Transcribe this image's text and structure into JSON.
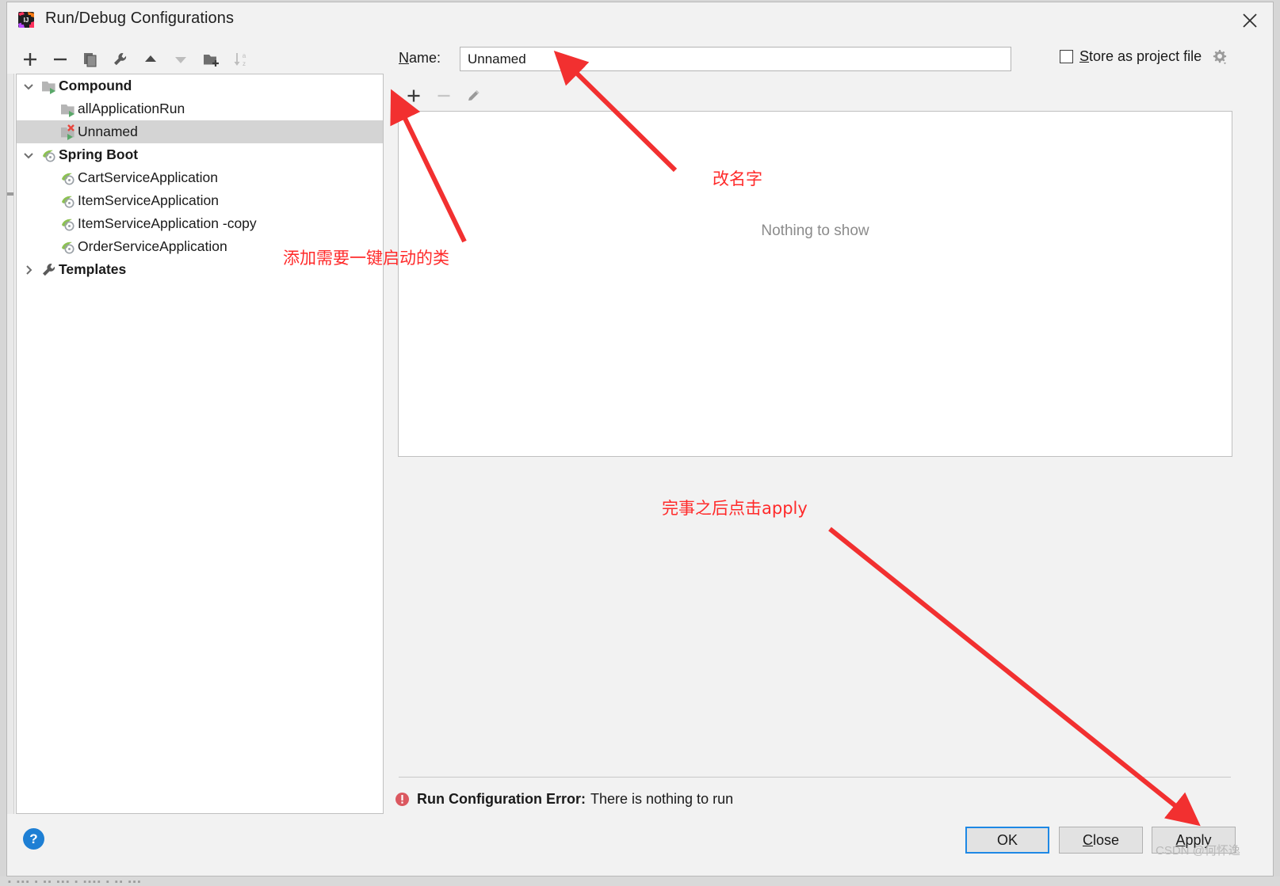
{
  "window": {
    "title": "Run/Debug Configurations",
    "app_icon": "intellij-idea-icon",
    "close_icon": "close-icon"
  },
  "left_toolbar": {
    "buttons": [
      {
        "name": "add-configuration-button",
        "icon": "plus-icon",
        "enabled": true
      },
      {
        "name": "remove-configuration-button",
        "icon": "minus-icon",
        "enabled": true
      },
      {
        "name": "copy-configuration-button",
        "icon": "copy-icon",
        "enabled": true
      },
      {
        "name": "edit-templates-button",
        "icon": "wrench-icon",
        "enabled": true
      },
      {
        "name": "move-up-button",
        "icon": "triangle-up-icon",
        "enabled": true
      },
      {
        "name": "move-down-button",
        "icon": "triangle-down-icon",
        "enabled": false
      },
      {
        "name": "move-into-folder-button",
        "icon": "folder-add-icon",
        "enabled": true
      },
      {
        "name": "sort-alphabetically-button",
        "icon": "sort-az-icon",
        "enabled": false
      }
    ]
  },
  "tree": {
    "items": [
      {
        "label": "Compound",
        "level": 0,
        "bold": true,
        "twisty": "chevron-down-icon",
        "icon": "compound-folder-run-icon",
        "selected": false
      },
      {
        "label": "allApplicationRun",
        "level": 1,
        "bold": false,
        "twisty": "",
        "icon": "compound-run-icon",
        "selected": false
      },
      {
        "label": "Unnamed",
        "level": 1,
        "bold": false,
        "twisty": "",
        "icon": "compound-run-error-icon",
        "selected": true
      },
      {
        "label": "Spring Boot",
        "level": 0,
        "bold": true,
        "twisty": "chevron-down-icon",
        "icon": "spring-boot-icon",
        "selected": false
      },
      {
        "label": "CartServiceApplication",
        "level": 1,
        "bold": false,
        "twisty": "",
        "icon": "spring-boot-icon",
        "selected": false
      },
      {
        "label": "ItemServiceApplication",
        "level": 1,
        "bold": false,
        "twisty": "",
        "icon": "spring-boot-icon",
        "selected": false
      },
      {
        "label": "ItemServiceApplication -copy",
        "level": 1,
        "bold": false,
        "twisty": "",
        "icon": "spring-boot-icon",
        "selected": false
      },
      {
        "label": "OrderServiceApplication",
        "level": 1,
        "bold": false,
        "twisty": "",
        "icon": "spring-boot-icon",
        "selected": false
      },
      {
        "label": "Templates",
        "level": 0,
        "bold": true,
        "twisty": "chevron-right-icon",
        "icon": "wrench-icon",
        "selected": false
      }
    ]
  },
  "form": {
    "name_label_prefix": "N",
    "name_label_rest": "ame:",
    "name_value": "Unnamed",
    "name_placeholder": "",
    "store_as_project_file_prefix": "S",
    "store_as_project_file_rest": "tore as project file",
    "store_as_project_file_checked": false,
    "gear_icon": "gear-dropdown-icon"
  },
  "panel_toolbar": {
    "buttons": [
      {
        "name": "add-item-button",
        "icon": "plus-icon",
        "enabled": true
      },
      {
        "name": "remove-item-button",
        "icon": "minus-icon",
        "enabled": false
      },
      {
        "name": "edit-item-button",
        "icon": "pencil-icon",
        "enabled": false
      }
    ]
  },
  "content": {
    "empty_message": "Nothing to show"
  },
  "status": {
    "error_icon": "error-exclamation-icon",
    "error_title": "Run Configuration Error:",
    "error_message": "There is nothing to run"
  },
  "footer": {
    "help_icon": "question-mark-icon",
    "help_label": "?",
    "ok_label": "OK",
    "close_label_prefix": "C",
    "close_label_rest": "lose",
    "apply_label_prefix": "A",
    "apply_label_rest": "pply",
    "watermark": "CSDN @何怀逸"
  },
  "annotations": [
    {
      "name": "annotation-rename",
      "text": "改名字",
      "color": "#ff2a2a"
    },
    {
      "name": "annotation-add-class",
      "text": "添加需要一键启动的类",
      "color": "#ff2a2a"
    },
    {
      "name": "annotation-click-apply",
      "text": "完事之后点击apply",
      "color": "#ff2a2a"
    }
  ],
  "colors": {
    "annotation_red": "#ff2a2a",
    "selection_gray": "#d4d4d4",
    "focus_blue": "#1e88e5",
    "error_red": "#db5860",
    "spring_green": "#6cb33e",
    "help_blue": "#1e7fd4"
  }
}
